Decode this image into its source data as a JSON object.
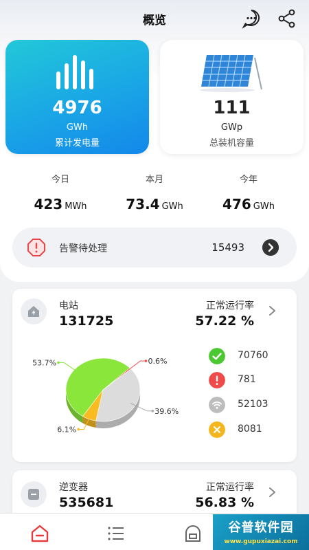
{
  "header": {
    "title": "概览",
    "chat_icon": "chat-bubble-icon",
    "share_icon": "share-icon"
  },
  "summary_cards": {
    "generation": {
      "value": "4976",
      "unit": "GWh",
      "label": "累计发电量",
      "icon": "bar-chart-icon"
    },
    "capacity": {
      "value": "111",
      "unit": "GWp",
      "label": "总装机容量",
      "icon": "solar-panel-icon"
    }
  },
  "periods": [
    {
      "label": "今日",
      "value": "423",
      "unit": "MWh"
    },
    {
      "label": "本月",
      "value": "73.4",
      "unit": "GWh"
    },
    {
      "label": "今年",
      "value": "476",
      "unit": "GWh"
    }
  ],
  "alarm": {
    "label": "告警待处理",
    "count": "15493",
    "icon": "alert-octagon-icon",
    "go_icon": "chevron-right-icon"
  },
  "station_card": {
    "name": "电站",
    "count": "131725",
    "rate_label": "正常运行率",
    "rate": "57.22 %",
    "status": [
      {
        "name": "normal",
        "icon": "check-icon",
        "color": "#4cc832",
        "count": "70760"
      },
      {
        "name": "fault",
        "icon": "exclamation-icon",
        "color": "#ef4b4b",
        "count": "781"
      },
      {
        "name": "offline",
        "icon": "wifi-icon",
        "color": "#bdbdbd",
        "count": "52103"
      },
      {
        "name": "alarm",
        "icon": "x-icon",
        "color": "#f5b51c",
        "count": "8081"
      }
    ]
  },
  "chart_data": {
    "type": "pie",
    "slices": [
      {
        "label": "53.7%",
        "value": 53.7,
        "color": "#8ae63a"
      },
      {
        "label": "0.6%",
        "value": 0.6,
        "color": "#ef4b4b"
      },
      {
        "label": "39.6%",
        "value": 39.6,
        "color": "#dcdcdc"
      },
      {
        "label": "6.1%",
        "value": 6.1,
        "color": "#f8bb22"
      }
    ]
  },
  "inverter_card": {
    "name": "逆变器",
    "count": "535681",
    "rate_label": "正常运行率",
    "rate": "56.83 %"
  },
  "bottom_nav": [
    {
      "name": "home",
      "icon": "home-icon",
      "active_color": "#e43c3c"
    },
    {
      "name": "list",
      "icon": "list-icon"
    },
    {
      "name": "device",
      "icon": "device-icon"
    }
  ],
  "watermark": {
    "line1": "谷普软件园",
    "line2": "www.gupuxiazai.com"
  }
}
